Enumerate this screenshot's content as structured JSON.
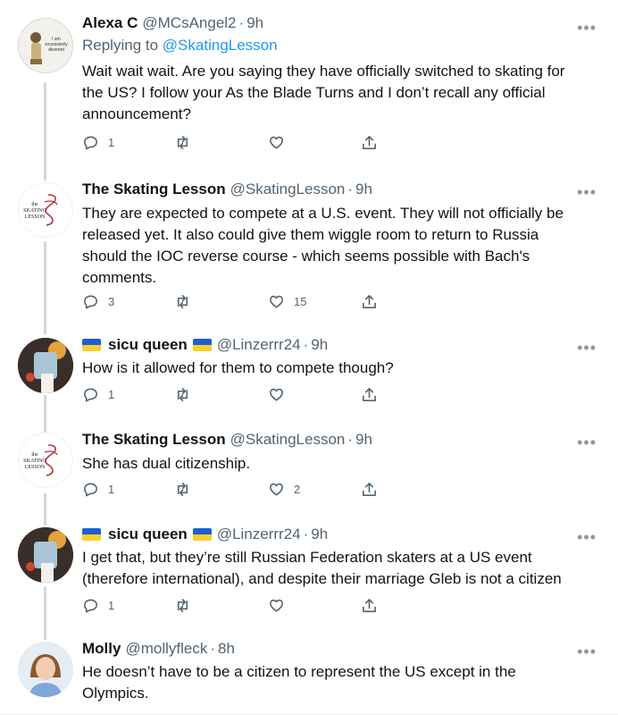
{
  "tweets": [
    {
      "name": "Alexa C",
      "handle": "@MCsAngel2",
      "dot": "·",
      "time": "9h",
      "reply_prefix": "Replying to",
      "reply_to": "@SkatingLesson",
      "text": "Wait wait wait. Are you saying they have officially switched to skating for the US? I follow your As the Blade Turns and I don’t recall any official announcement?",
      "avatar_caption": "I am excessively diverted",
      "reply_count": "1",
      "like_count": ""
    },
    {
      "name": "The Skating Lesson",
      "handle": "@SkatingLesson",
      "dot": "·",
      "time": "9h",
      "text": "They are expected to compete at a U.S. event. They will not officially be released yet. It also could give them wiggle room to return to Russia should the IOC reverse course - which seems possible with Bach's comments.",
      "avatar_caption": "the SKATING LESSON",
      "reply_count": "3",
      "like_count": "15"
    },
    {
      "name": "sicu queen",
      "handle": "@Linzerrr24",
      "dot": "·",
      "time": "9h",
      "text": "How is it allowed for them to compete though?",
      "reply_count": "1",
      "like_count": ""
    },
    {
      "name": "The Skating Lesson",
      "handle": "@SkatingLesson",
      "dot": "·",
      "time": "9h",
      "text": "She has dual citizenship.",
      "avatar_caption": "the SKATING LESSON",
      "reply_count": "1",
      "like_count": "2"
    },
    {
      "name": "sicu queen",
      "handle": "@Linzerrr24",
      "dot": "·",
      "time": "9h",
      "text": "I get that, but they’re still Russian Federation skaters at a US event (therefore international), and despite their marriage Gleb is not a citizen",
      "reply_count": "1",
      "like_count": ""
    },
    {
      "name": "Molly",
      "handle": "@mollyfleck",
      "dot": "·",
      "time": "8h",
      "text": "He doesn’t have to be a citizen to represent the US except in the Olympics.",
      "reply_count": "",
      "like_count": ""
    }
  ],
  "icons": {
    "more": "more-icon",
    "reply": "reply-icon",
    "retweet": "retweet-icon",
    "like": "heart-icon",
    "share": "share-icon",
    "flag": "ukraine-flag-icon"
  },
  "colors": {
    "link": "#1d9bf0",
    "secondary_text": "#536471",
    "thread_line": "#cfd9de",
    "skating_lesson_red": "#b0333f"
  }
}
